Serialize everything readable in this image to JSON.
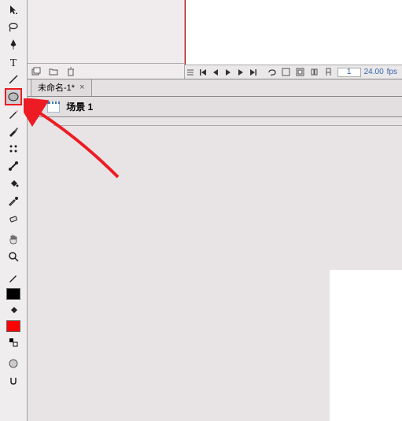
{
  "toolbox": {
    "tools": [
      {
        "name": "selection-tool",
        "glyph": "arrow"
      },
      {
        "name": "lasso-tool",
        "glyph": "lasso"
      },
      {
        "name": "pen-tool",
        "glyph": "pen"
      },
      {
        "name": "text-tool",
        "glyph": "text"
      },
      {
        "name": "line-tool",
        "glyph": "line"
      },
      {
        "name": "oval-tool",
        "glyph": "oval",
        "highlighted": true
      },
      {
        "name": "pencil-tool",
        "glyph": "pencil"
      },
      {
        "name": "brush-tool",
        "glyph": "brush"
      },
      {
        "name": "deco-tool",
        "glyph": "deco"
      },
      {
        "name": "bone-tool",
        "glyph": "bone"
      },
      {
        "name": "bucket-tool",
        "glyph": "bucket"
      },
      {
        "name": "eyedropper-tool",
        "glyph": "eyedrop"
      },
      {
        "name": "eraser-tool",
        "glyph": "eraser"
      },
      {
        "name": "hand-tool",
        "glyph": "hand"
      },
      {
        "name": "zoom-tool",
        "glyph": "zoom"
      }
    ]
  },
  "timeline": {
    "frame": "1",
    "fps_value": "24.00",
    "fps_label": "fps"
  },
  "document": {
    "tab_name": "未命名-1*",
    "scene_name": "场景 1"
  }
}
